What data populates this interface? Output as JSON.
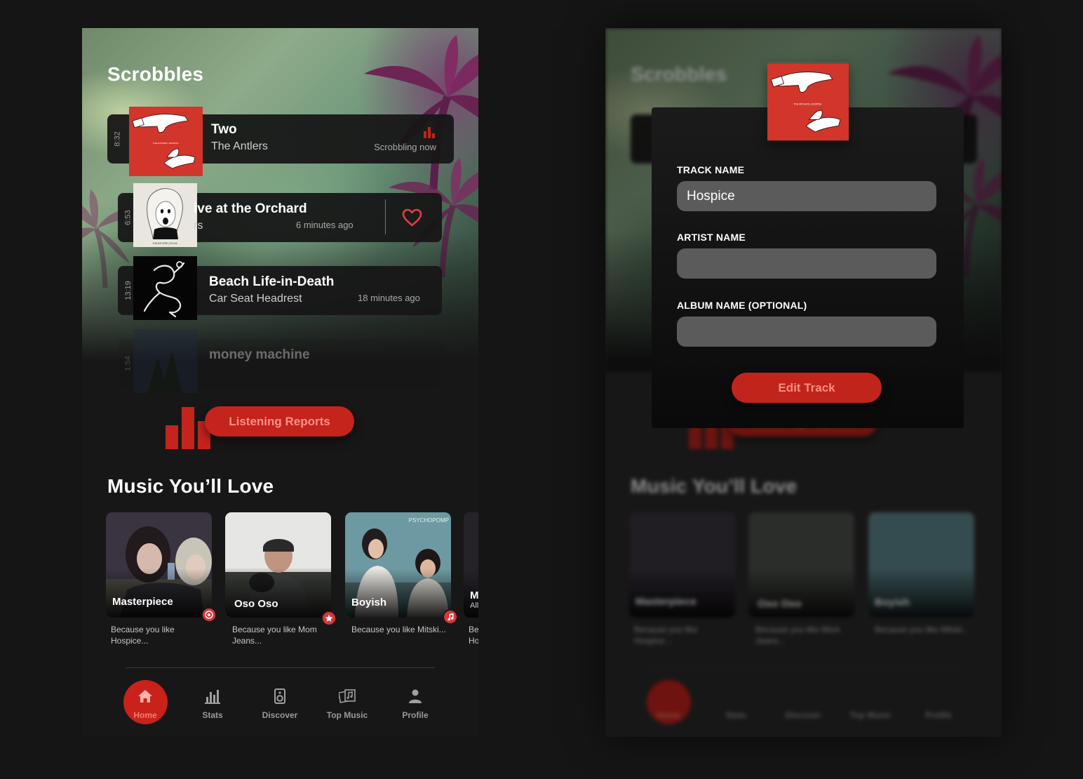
{
  "colors": {
    "accent": "#c4241c",
    "accent_text": "#ff8f85",
    "background": "#171717",
    "card": "#161616"
  },
  "scrobbles": {
    "title": "Scrobbles",
    "items": [
      {
        "time": "8:32",
        "title": "Two",
        "artist": "The Antlers",
        "status": "Scrobbling now",
        "cover": "hospice-cover"
      },
      {
        "time": "6:53",
        "title": "ive at the Orchard",
        "artist": "rs",
        "status": "6 minutes ago",
        "cover": "sylvia-cover",
        "liked": true
      },
      {
        "time": "13:19",
        "title": "Beach Life-in-Death",
        "artist": "Car Seat Headrest",
        "status": "18 minutes ago",
        "cover": "twin-fantasy-cover"
      },
      {
        "time": "1:54",
        "title": "money machine",
        "artist": "",
        "status": "",
        "cover": "night-cover"
      }
    ]
  },
  "listening_reports": {
    "label": "Listening Reports"
  },
  "recommendations": {
    "title": "Music You’ll Love",
    "items": [
      {
        "name": "Masterpiece",
        "reason": "Because you like Hospice...",
        "badge": "target-icon"
      },
      {
        "name": "Oso Oso",
        "reason": "Because you like Mom Jeans...",
        "badge": "star-icon"
      },
      {
        "name": "Boyish",
        "reason": "Because you like Mitski...",
        "badge": "music-note-icon",
        "album_text": "PSYCHOPOMP"
      },
      {
        "name": "M",
        "sub": "All",
        "reason": "Be Ho"
      }
    ]
  },
  "nav": {
    "items": [
      {
        "label": "Home",
        "icon": "home-icon",
        "active": true
      },
      {
        "label": "Stats",
        "icon": "stats-icon"
      },
      {
        "label": "Discover",
        "icon": "speaker-icon"
      },
      {
        "label": "Top Music",
        "icon": "albums-icon"
      },
      {
        "label": "Profile",
        "icon": "profile-icon"
      }
    ]
  },
  "edit_modal": {
    "track_label": "TRACK NAME",
    "track_value": "Hospice",
    "artist_label": "ARTIST NAME",
    "artist_value": "",
    "album_label": "ALBUM NAME (OPTIONAL)",
    "album_value": "",
    "submit_label": "Edit Track"
  },
  "cover_text": {
    "hospice": "THE ANTLERS | HOSPICE",
    "sylvia": "THE ANTLERS | SYLVIA"
  }
}
